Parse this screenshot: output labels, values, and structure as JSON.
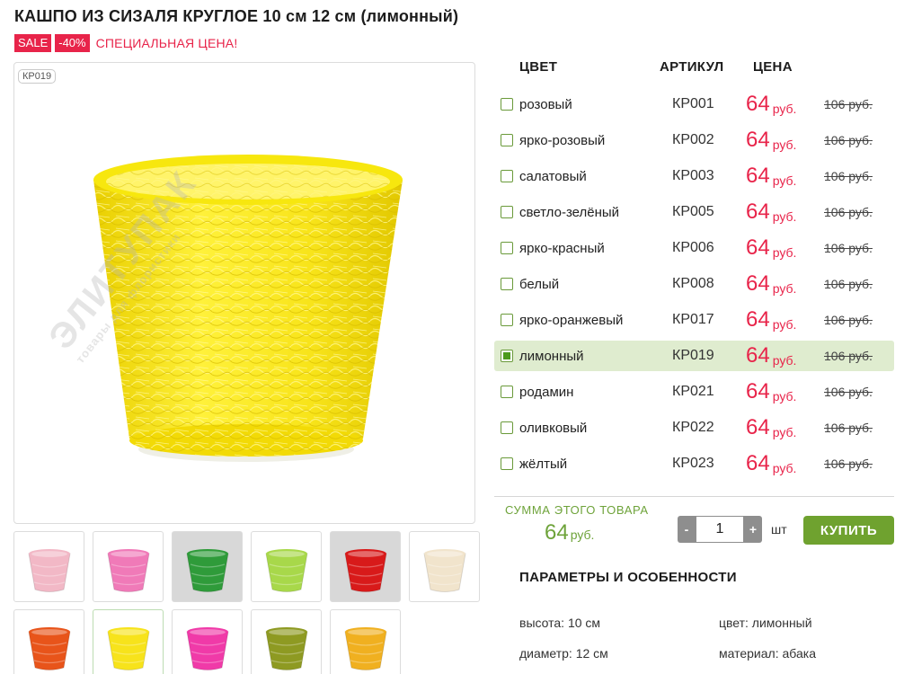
{
  "product": {
    "title": "КАШПО ИЗ СИЗАЛЯ КРУГЛОЕ 10 см 12 см (лимонный)",
    "sale_badge": "SALE",
    "discount_badge": "-40%",
    "special_label": "СПЕЦИАЛЬНАЯ ЦЕНА!",
    "image_sku": "КР019",
    "image_color": "#f7e31b"
  },
  "table": {
    "headers": {
      "color": "ЦВЕТ",
      "article": "АРТИКУЛ",
      "price": "ЦЕНА"
    },
    "currency": "руб.",
    "rows": [
      {
        "color": "розовый",
        "article": "КР001",
        "price": "64",
        "old_price": "106 руб.",
        "selected": false
      },
      {
        "color": "ярко-розовый",
        "article": "КР002",
        "price": "64",
        "old_price": "106 руб.",
        "selected": false
      },
      {
        "color": "салатовый",
        "article": "КР003",
        "price": "64",
        "old_price": "106 руб.",
        "selected": false
      },
      {
        "color": "светло-зелёный",
        "article": "КР005",
        "price": "64",
        "old_price": "106 руб.",
        "selected": false
      },
      {
        "color": "ярко-красный",
        "article": "КР006",
        "price": "64",
        "old_price": "106 руб.",
        "selected": false
      },
      {
        "color": "белый",
        "article": "КР008",
        "price": "64",
        "old_price": "106 руб.",
        "selected": false
      },
      {
        "color": "ярко-оранжевый",
        "article": "КР017",
        "price": "64",
        "old_price": "106 руб.",
        "selected": false
      },
      {
        "color": "лимонный",
        "article": "КР019",
        "price": "64",
        "old_price": "106 руб.",
        "selected": true
      },
      {
        "color": "родамин",
        "article": "КР021",
        "price": "64",
        "old_price": "106 руб.",
        "selected": false
      },
      {
        "color": "оливковый",
        "article": "КР022",
        "price": "64",
        "old_price": "106 руб.",
        "selected": false
      },
      {
        "color": "жёлтый",
        "article": "КР023",
        "price": "64",
        "old_price": "106 руб.",
        "selected": false
      }
    ]
  },
  "thumbnails": [
    {
      "color": "#f2b8c6",
      "dark": false,
      "active": false
    },
    {
      "color": "#f07ab8",
      "dark": false,
      "active": false
    },
    {
      "color": "#2f9b3a",
      "dark": true,
      "active": false
    },
    {
      "color": "#a8d84a",
      "dark": false,
      "active": false
    },
    {
      "color": "#d81a1a",
      "dark": true,
      "active": false
    },
    {
      "color": "#f1e4cc",
      "dark": false,
      "active": false
    },
    {
      "color": "#e8541a",
      "dark": false,
      "active": false
    },
    {
      "color": "#f7e31b",
      "dark": false,
      "active": true
    },
    {
      "color": "#f03aa8",
      "dark": false,
      "active": false
    },
    {
      "color": "#8e9a22",
      "dark": false,
      "active": false
    },
    {
      "color": "#f0b020",
      "dark": false,
      "active": false
    }
  ],
  "summary": {
    "label": "СУММА ЭТОГО ТОВАРА",
    "value": "64",
    "currency": "руб."
  },
  "cart": {
    "minus": "-",
    "plus": "+",
    "quantity": "1",
    "unit": "шт",
    "buy_label": "КУПИТЬ"
  },
  "params": {
    "title": "ПАРАМЕТРЫ И ОСОБЕННОСТИ",
    "height": "высота: 10 см",
    "diameter": "диаметр: 12 см",
    "color": "цвет: лимонный",
    "material": "материал: абака"
  },
  "colors": {
    "accent_red": "#e8244a",
    "accent_green": "#6fa22f",
    "selected_row": "#dfeccf"
  }
}
